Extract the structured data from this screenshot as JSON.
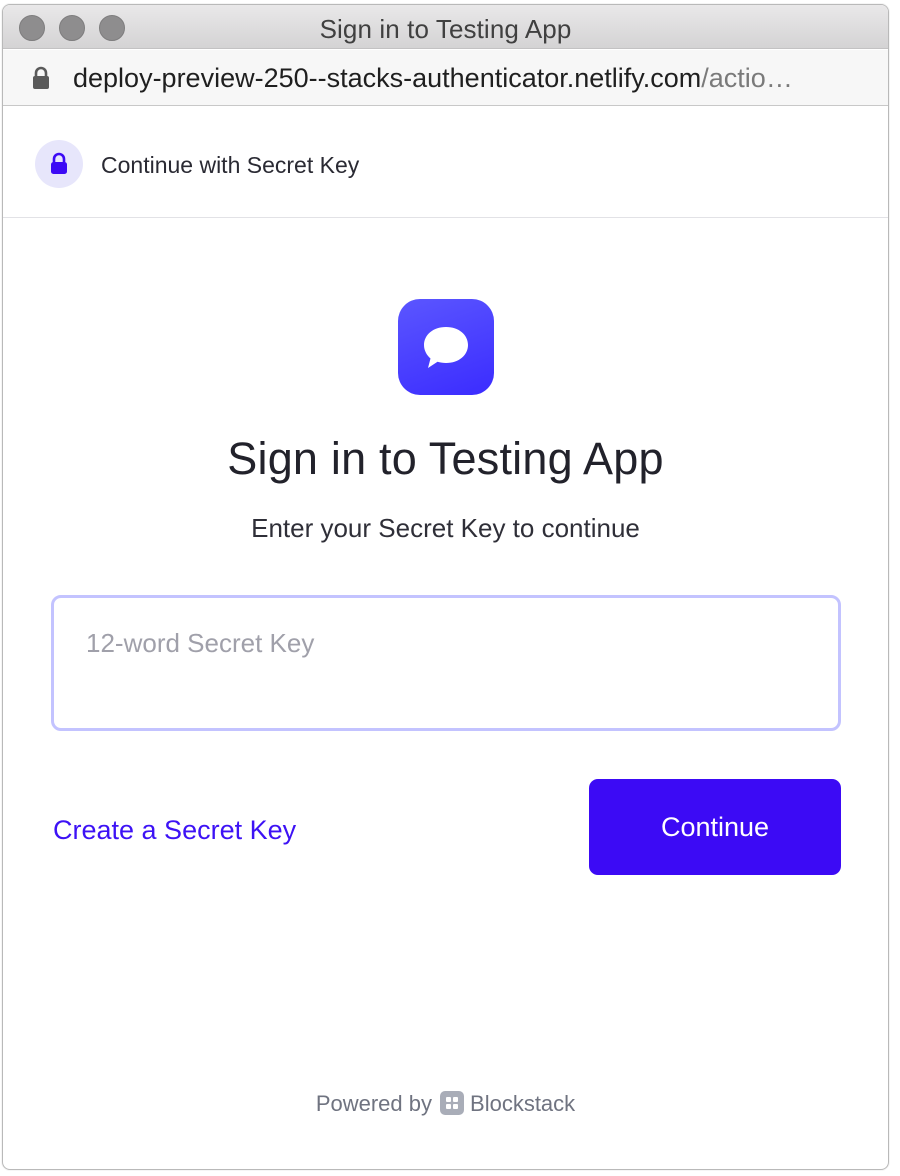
{
  "window": {
    "title": "Sign in to Testing App"
  },
  "address_bar": {
    "url_host": "deploy-preview-250--stacks-authenticator.netlify.com",
    "url_path": "/actio…",
    "icon": "lock-icon"
  },
  "header": {
    "label": "Continue with Secret Key",
    "icon": "lock-icon"
  },
  "app": {
    "icon": "chat-bubble-icon",
    "title": "Sign in to Testing App",
    "subtitle": "Enter your Secret Key to continue"
  },
  "form": {
    "secret_key_value": "",
    "secret_key_placeholder": "12-word Secret Key",
    "create_link_label": "Create a Secret Key",
    "continue_label": "Continue"
  },
  "footer": {
    "powered_by": "Powered by",
    "brand": "Blockstack",
    "icon": "blockstack-logo-icon"
  },
  "colors": {
    "accent": "#3c0af5",
    "link": "#3d12f5",
    "input_border": "#c3c3ff",
    "badge_bg": "#e7e6fb",
    "app_icon": "#4a3dff"
  }
}
